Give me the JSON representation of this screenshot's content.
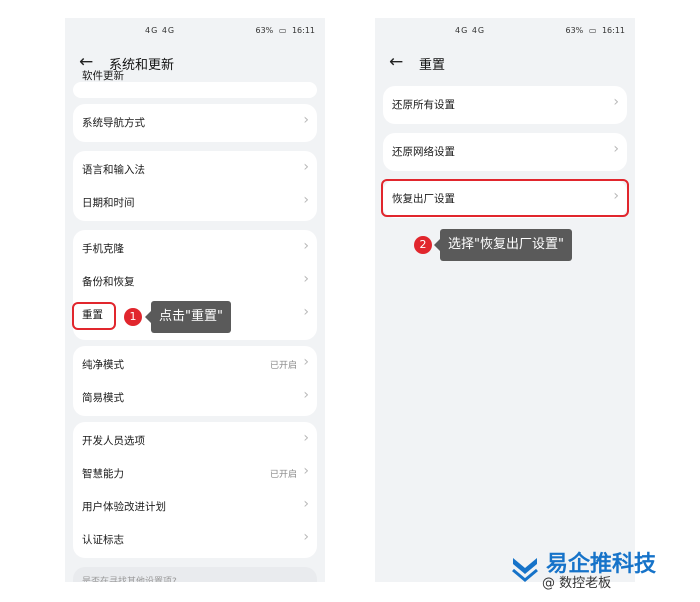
{
  "status_bar": {
    "sim": "4G 4G",
    "battery": "63%",
    "time": "16:11"
  },
  "left_screen": {
    "title": "系统和更新",
    "partial_item": "软件更新",
    "groups": [
      [
        {
          "label": "系统导航方式",
          "value": ""
        }
      ],
      [
        {
          "label": "语言和输入法",
          "value": ""
        },
        {
          "label": "日期和时间",
          "value": ""
        }
      ],
      [
        {
          "label": "手机克隆",
          "value": ""
        },
        {
          "label": "备份和恢复",
          "value": ""
        },
        {
          "label": "重置",
          "value": ""
        }
      ],
      [
        {
          "label": "纯净模式",
          "value": "已开启"
        },
        {
          "label": "简易模式",
          "value": ""
        }
      ],
      [
        {
          "label": "开发人员选项",
          "value": ""
        },
        {
          "label": "智慧能力",
          "value": "已开启"
        },
        {
          "label": "用户体验改进计划",
          "value": ""
        },
        {
          "label": "认证标志",
          "value": ""
        }
      ]
    ],
    "bottom_partial": "是否在寻找其他设置项?"
  },
  "right_screen": {
    "title": "重置",
    "items": [
      {
        "label": "还原所有设置"
      },
      {
        "label": "还原网络设置"
      },
      {
        "label": "恢复出厂设置"
      }
    ]
  },
  "annotations": {
    "step1_number": "1",
    "step1_text": "点击\"重置\"",
    "step2_number": "2",
    "step2_text": "选择\"恢复出厂设置\""
  },
  "icons": {
    "back": "back-arrow-icon",
    "chevron": "chevron-right-icon"
  },
  "colors": {
    "highlight": "#e1262d",
    "tooltip_bg": "#5a5a5a",
    "watermark": "#1673c9"
  },
  "watermark": {
    "brand": "易企推科技",
    "sub": "@ 数控老板"
  }
}
